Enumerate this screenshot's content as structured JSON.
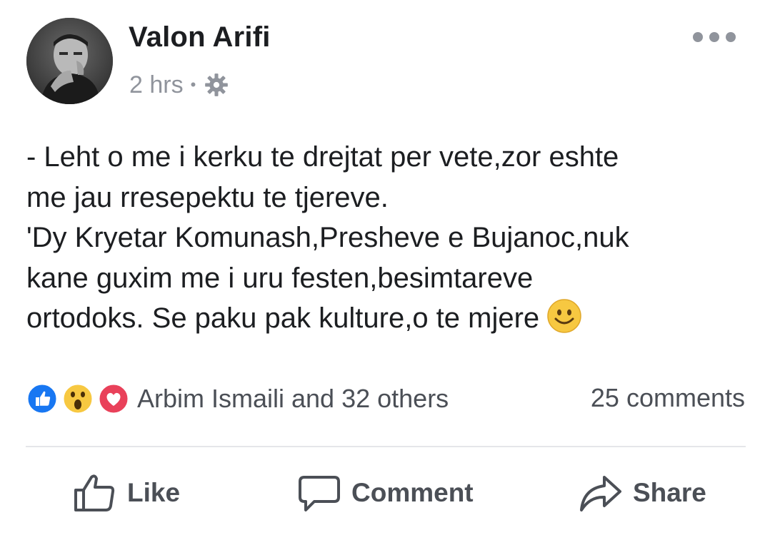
{
  "post": {
    "author": "Valon Arifi",
    "time": "2 hrs",
    "separator": "•",
    "privacy_icon": "gear-icon",
    "more_icon": "more-options-icon",
    "text_lines": [
      "- Leht o me i kerku te drejtat per vete,zor eshte",
      "me jau rresepektu te tjereve.",
      "'Dy Kryetar Komunash,Presheve e Bujanoc,nuk",
      "kane guxim me i uru festen,besimtareve",
      "ortodoks. Se paku pak kulture,o te mjere"
    ],
    "emoji": "smiley-emoji"
  },
  "engagement": {
    "reaction_icons": [
      "like-reaction-icon",
      "wow-reaction-icon",
      "love-reaction-icon"
    ],
    "reaction_summary": "Arbim Ismaili and 32 others",
    "comments_count": "25 comments"
  },
  "actions": {
    "like_label": "Like",
    "comment_label": "Comment",
    "share_label": "Share"
  },
  "colors": {
    "text": "#1c1e21",
    "meta": "#90949c",
    "action": "#4b4f56",
    "like_blue": "#1877f2",
    "love_red": "#e9415a",
    "wow_yellow": "#f7c841",
    "divider": "#e5e6e9"
  }
}
